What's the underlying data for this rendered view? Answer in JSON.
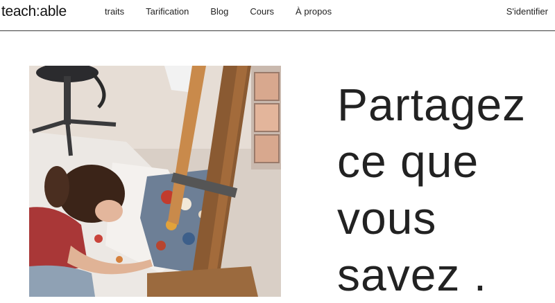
{
  "header": {
    "logo": "teach:able",
    "nav": [
      "traits",
      "Tarification",
      "Blog",
      "Cours",
      "À propos"
    ],
    "signin": "S'identifier"
  },
  "hero": {
    "heading_lines": [
      "Partagez",
      "ce que",
      "vous",
      "savez ."
    ],
    "image_icon": "artist-painting-photo"
  }
}
